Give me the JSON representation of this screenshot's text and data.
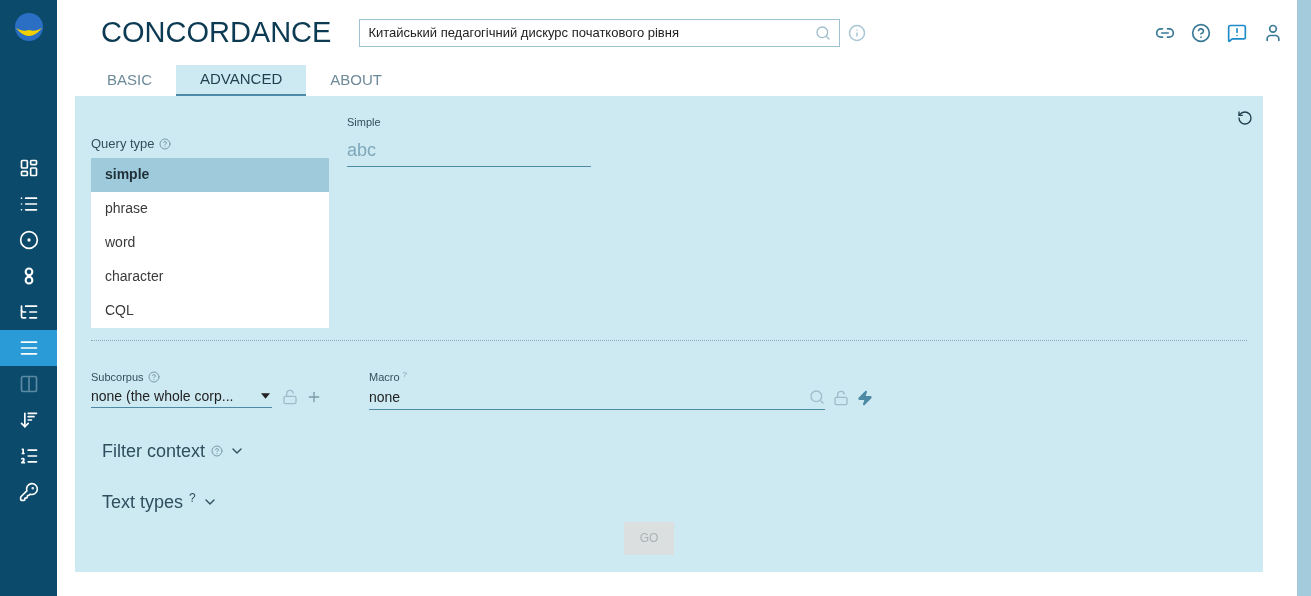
{
  "sidebar": {
    "items": [
      {
        "kind": "dashboard",
        "selected": false,
        "disabled": false
      },
      {
        "kind": "list",
        "selected": false,
        "disabled": false
      },
      {
        "kind": "target",
        "selected": false,
        "disabled": false
      },
      {
        "kind": "rings",
        "selected": false,
        "disabled": false
      },
      {
        "kind": "dot-list",
        "selected": false,
        "disabled": false
      },
      {
        "kind": "concordance",
        "selected": true,
        "disabled": false
      },
      {
        "kind": "parallel",
        "selected": false,
        "disabled": true
      },
      {
        "kind": "sort-list",
        "selected": false,
        "disabled": false
      },
      {
        "kind": "n-list",
        "selected": false,
        "disabled": false
      },
      {
        "kind": "key-list",
        "selected": false,
        "disabled": false
      }
    ]
  },
  "header": {
    "title": "CONCORDANCE",
    "corpus": "Китайський педагогічний дискурс початкового рівня"
  },
  "tabs": [
    {
      "label": "BASIC",
      "selected": false
    },
    {
      "label": "ADVANCED",
      "selected": true
    },
    {
      "label": "ABOUT",
      "selected": false
    }
  ],
  "query_type": {
    "label": "Query type",
    "options": [
      {
        "label": "simple",
        "selected": true
      },
      {
        "label": "phrase",
        "selected": false
      },
      {
        "label": "word",
        "selected": false
      },
      {
        "label": "character",
        "selected": false
      },
      {
        "label": "CQL",
        "selected": false
      }
    ]
  },
  "query": {
    "label": "Simple",
    "placeholder": "abc"
  },
  "subcorpus": {
    "label": "Subcorpus",
    "value": "none (the whole corp..."
  },
  "macro": {
    "label": "Macro",
    "sup": "?",
    "value": "none"
  },
  "sections": [
    {
      "label": "Filter context",
      "kind": "circle-help",
      "expanded": false
    },
    {
      "label": "Text types",
      "kind": "mark-help",
      "sup": "?",
      "expanded": false
    }
  ],
  "go": {
    "label": "GO",
    "disabled": true
  }
}
